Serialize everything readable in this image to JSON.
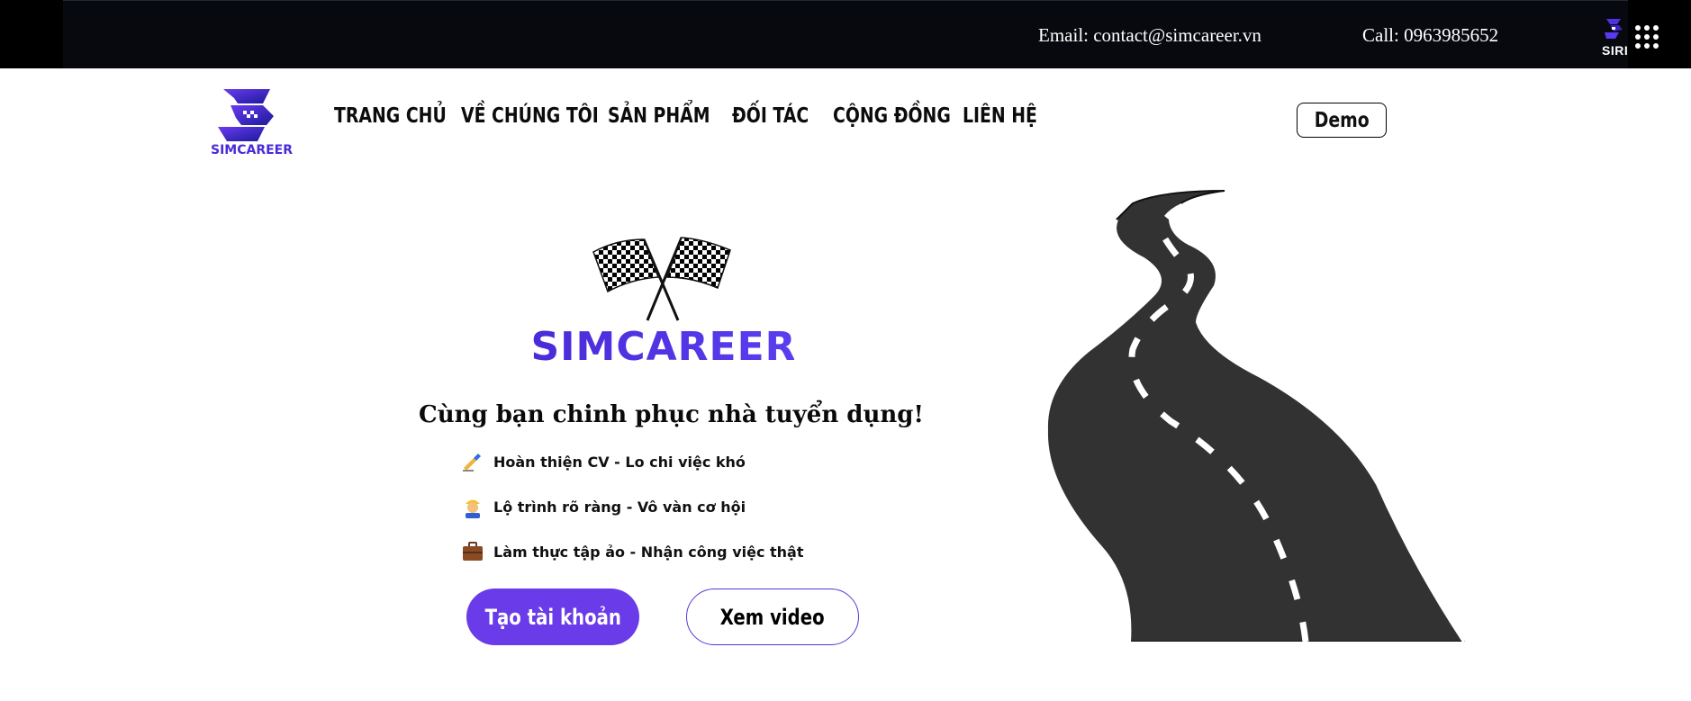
{
  "topbar": {
    "email": "Email: contact@simcareer.vn",
    "call": "Call: 0963985652",
    "logo_label": "SIRI"
  },
  "brand": {
    "name": "SIMCAREER"
  },
  "nav": {
    "items": [
      {
        "label": "TRANG CHỦ"
      },
      {
        "label": "VỀ CHÚNG TÔI"
      },
      {
        "label": "SẢN PHẨM"
      },
      {
        "label": "ĐỐI TÁC"
      },
      {
        "label": "CỘNG ĐỒNG"
      },
      {
        "label": "LIÊN HỆ"
      }
    ],
    "demo_label": "Demo"
  },
  "hero": {
    "brand_text": "SIMCAREER",
    "headline": "Cùng bạn chinh phục nhà tuyển dụng!",
    "features": [
      {
        "icon": "writing-hand-icon",
        "text": "Hoàn thiện CV - Lo chi việc khó"
      },
      {
        "icon": "construction-worker-icon",
        "text": "Lộ trình rõ ràng - Vô vàn cơ hội"
      },
      {
        "icon": "briefcase-icon",
        "text": "Làm thực tập ảo - Nhận công việc thật"
      }
    ],
    "primary_button": "Tạo tài khoản",
    "secondary_button": "Xem video"
  },
  "colors": {
    "accent": "#6a3be8",
    "topbar": "#07090f",
    "road": "#333333"
  }
}
